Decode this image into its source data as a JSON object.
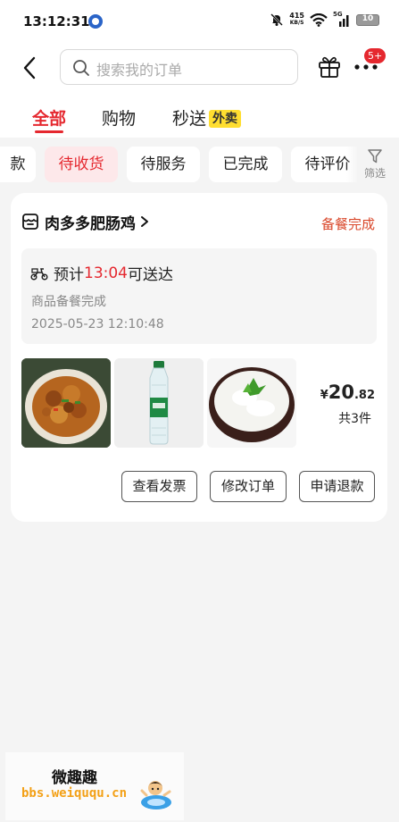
{
  "status_bar": {
    "time": "13:12:31",
    "net_speed_value": "415",
    "net_speed_unit": "KB/S",
    "signal_label": "5G",
    "battery": "10"
  },
  "header": {
    "search_placeholder": "搜索我的订单",
    "badge": "5+"
  },
  "category_tabs": [
    {
      "label": "全部",
      "active": true
    },
    {
      "label": "购物",
      "active": false
    },
    {
      "label": "秒送",
      "tag": "外卖",
      "active": false
    }
  ],
  "filters": {
    "chips": [
      "款",
      "待收货",
      "待服务",
      "已完成",
      "待评价"
    ],
    "active_index": 1,
    "filter_label": "筛选"
  },
  "order": {
    "shop_name": "肉多多肥肠鸡",
    "status": "备餐完成",
    "delivery_prefix": "预计",
    "delivery_time": "13:04",
    "delivery_suffix": "可送达",
    "delivery_status": "商品备餐完成",
    "delivery_datetime": "2025-05-23 12:10:48",
    "price_currency": "¥",
    "price_int": "20",
    "price_dec": ".82",
    "item_count": "共3件",
    "actions": [
      "查看发票",
      "修改订单",
      "申请退款"
    ]
  },
  "watermark": {
    "title": "微趣趣",
    "url": "bbs.weiququ.cn"
  },
  "colors": {
    "accent": "#e5282f",
    "status_orange": "#d9472a",
    "chip_active_bg": "#fde8ea",
    "tag_yellow": "#ffde30"
  }
}
